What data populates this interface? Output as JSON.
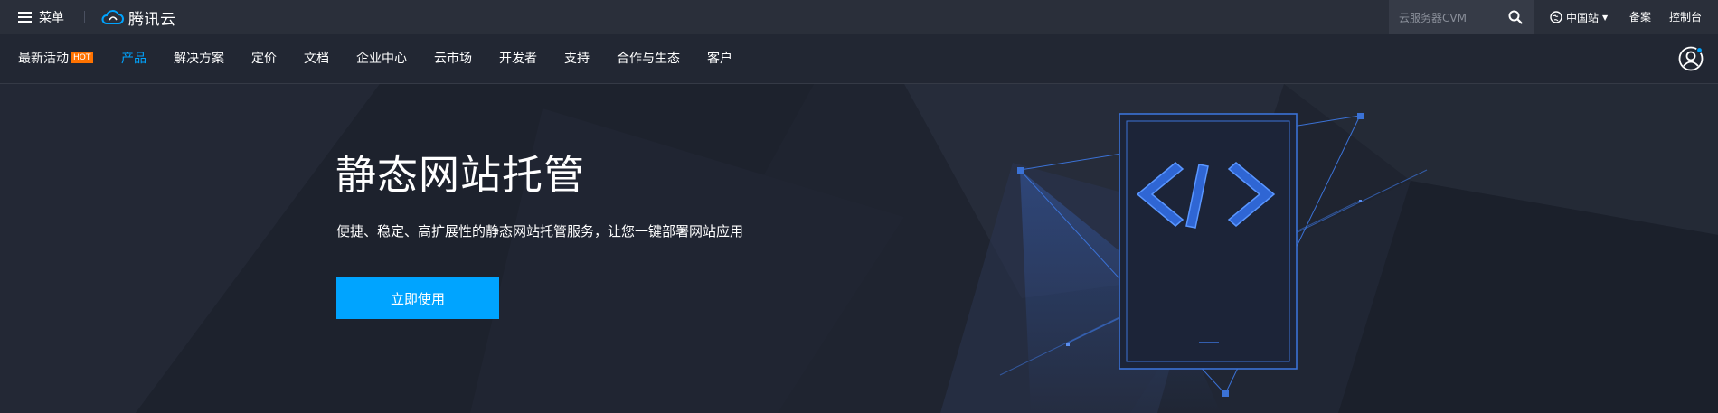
{
  "topbar": {
    "menu_label": "菜单",
    "logo_text": "腾讯云",
    "search_placeholder": "云服务器CVM",
    "region_label": "中国站",
    "record_label": "备案",
    "console_label": "控制台"
  },
  "nav": {
    "items": [
      "最新活动",
      "产品",
      "解决方案",
      "定价",
      "文档",
      "企业中心",
      "云市场",
      "开发者",
      "支持",
      "合作与生态",
      "客户"
    ],
    "hot_badge": "HOT",
    "active_index": 1
  },
  "hero": {
    "title": "静态网站托管",
    "subtitle": "便捷、稳定、高扩展性的静态网站托管服务，让您一键部署网站应用",
    "cta_label": "立即使用",
    "illustration_icon": "code-brackets-icon"
  },
  "colors": {
    "accent": "#00a4ff",
    "hot_badge": "#ff7200",
    "background": "#1f2430",
    "topbar_bg": "#2a2f3a"
  }
}
